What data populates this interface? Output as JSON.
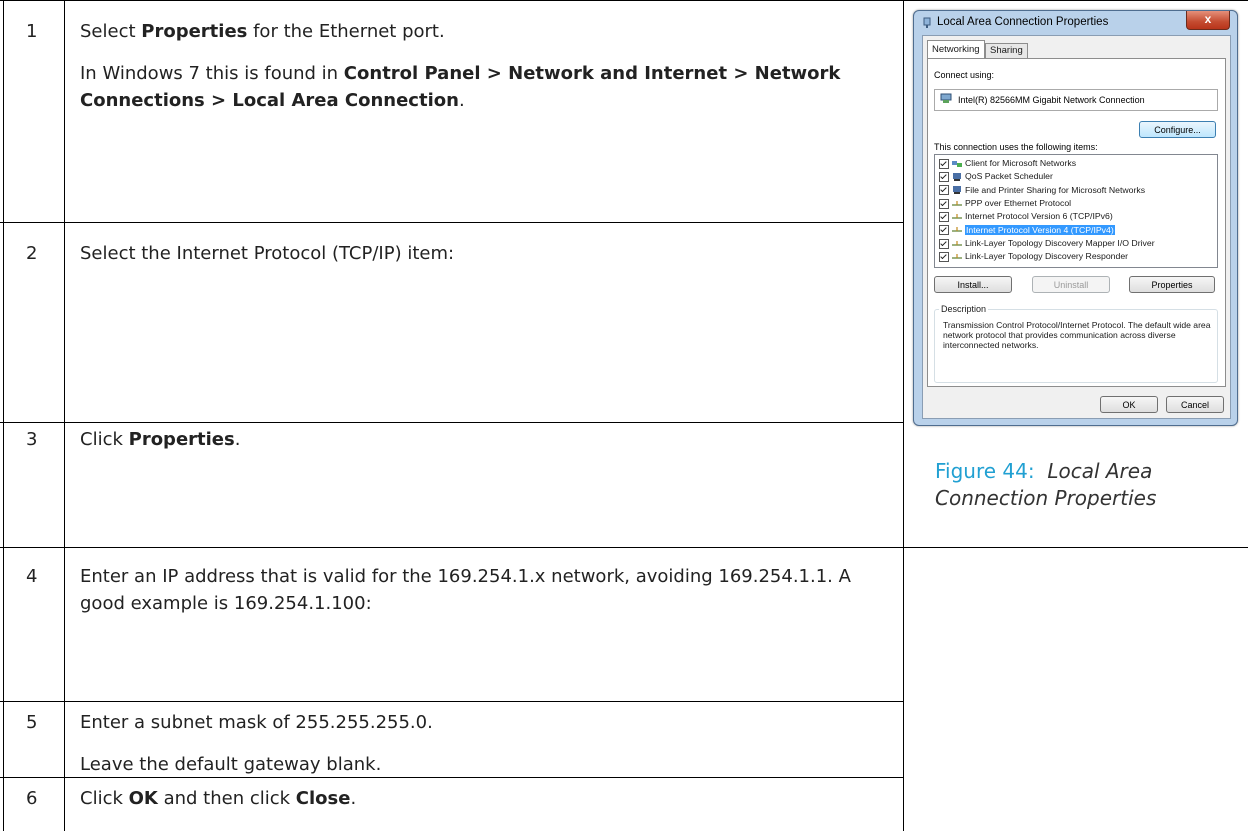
{
  "rows": [
    {
      "num": "1",
      "lines": [
        [
          {
            "t": "Select "
          },
          {
            "t": "Properties",
            "b": true
          },
          {
            "t": " for the Ethernet port."
          }
        ],
        [
          {
            "t": "In Windows 7 this is found in "
          },
          {
            "t": "Control Panel > Network and Internet > Network Connections > Local Area Connection",
            "b": true
          },
          {
            "t": "."
          }
        ]
      ]
    },
    {
      "num": "2",
      "lines": [
        [
          {
            "t": "Select the Internet Protocol (TCP/IP) item:"
          }
        ]
      ]
    },
    {
      "num": "3",
      "lines": [
        [
          {
            "t": "Click "
          },
          {
            "t": "Properties",
            "b": true
          },
          {
            "t": "."
          }
        ]
      ]
    },
    {
      "num": "4",
      "lines": [
        [
          {
            "t": "Enter an IP address that is valid for the 169.254.1.x network, avoiding 169.254.1.1.  A good example is 169.254.1.100:"
          }
        ]
      ]
    },
    {
      "num": "5",
      "lines": [
        [
          {
            "t": "Enter a subnet mask of 255.255.255.0."
          }
        ],
        [
          {
            "t": "Leave the default gateway blank."
          }
        ]
      ]
    },
    {
      "num": "6",
      "lines": [
        [
          {
            "t": "Click "
          },
          {
            "t": "OK",
            "b": true
          },
          {
            "t": " and then click "
          },
          {
            "t": "Close",
            "b": true
          },
          {
            "t": "."
          }
        ]
      ]
    }
  ],
  "dialog": {
    "title": "Local Area Connection Properties",
    "close_label": "x",
    "tabs": [
      "Networking",
      "Sharing"
    ],
    "connect_using_label": "Connect using:",
    "adapter": "Intel(R) 82566MM Gigabit Network Connection",
    "configure_label": "Configure...",
    "items_label": "This connection uses the following items:",
    "items": [
      {
        "label": "Client for Microsoft Networks",
        "icon": "network-client-icon",
        "checked": true,
        "selected": false
      },
      {
        "label": "QoS Packet Scheduler",
        "icon": "service-icon",
        "checked": true,
        "selected": false
      },
      {
        "label": "File and Printer Sharing for Microsoft Networks",
        "icon": "service-icon",
        "checked": true,
        "selected": false
      },
      {
        "label": "PPP over Ethernet Protocol",
        "icon": "protocol-icon",
        "checked": true,
        "selected": false
      },
      {
        "label": "Internet Protocol Version 6 (TCP/IPv6)",
        "icon": "protocol-icon",
        "checked": true,
        "selected": false
      },
      {
        "label": "Internet Protocol Version 4 (TCP/IPv4)",
        "icon": "protocol-icon",
        "checked": true,
        "selected": true
      },
      {
        "label": "Link-Layer Topology Discovery Mapper I/O Driver",
        "icon": "protocol-icon",
        "checked": true,
        "selected": false
      },
      {
        "label": "Link-Layer Topology Discovery Responder",
        "icon": "protocol-icon",
        "checked": true,
        "selected": false
      }
    ],
    "install_label": "Install...",
    "uninstall_label": "Uninstall",
    "properties_label": "Properties",
    "description_legend": "Description",
    "description_text": "Transmission Control Protocol/Internet Protocol. The default wide area network protocol that provides communication across diverse interconnected networks.",
    "ok_label": "OK",
    "cancel_label": "Cancel"
  },
  "caption": {
    "prefix": "Figure 44:",
    "text": "Local Area Connection Properties"
  },
  "colors": {
    "caption_prefix": "#21a0d2",
    "selection": "#3399ff"
  }
}
